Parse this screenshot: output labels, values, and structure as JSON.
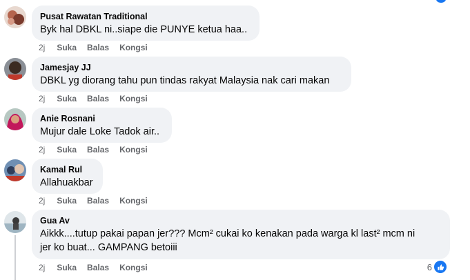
{
  "comments": [
    {
      "author": "Pusat Rawatan Traditional",
      "text": "Byk hal DBKL ni..siape die PUNYE ketua haa..",
      "time": "2j",
      "like_label": "Suka",
      "reply_label": "Balas",
      "share_label": "Kongsi",
      "avatar": "avatar-icon"
    },
    {
      "author": "Jamesjay JJ",
      "text": "DBKL yg diorang tahu pun tindas rakyat Malaysia nak cari makan",
      "time": "2j",
      "like_label": "Suka",
      "reply_label": "Balas",
      "share_label": "Kongsi",
      "avatar": "avatar-icon"
    },
    {
      "author": "Anie Rosnani",
      "text": "Mujur dale Loke Tadok air..",
      "time": "2j",
      "like_label": "Suka",
      "reply_label": "Balas",
      "share_label": "Kongsi",
      "avatar": "avatar-icon"
    },
    {
      "author": "Kamal Rul",
      "text": "Allahuakbar",
      "time": "2j",
      "like_label": "Suka",
      "reply_label": "Balas",
      "share_label": "Kongsi",
      "avatar": "avatar-icon"
    },
    {
      "author": "Gua Av",
      "text_line1": "Aikkk....tutup pakai papan jer??? Mcm² cukai ko kenakan pada warga kl last² mcm ni",
      "text_line2": "jer ko buat... GAMPANG betoiii",
      "time": "2j",
      "like_label": "Suka",
      "reply_label": "Balas",
      "share_label": "Kongsi",
      "avatar": "avatar-icon",
      "reaction_count": "6",
      "reaction_icon": "like-icon"
    }
  ],
  "colors": {
    "bubble": "#f0f2f5",
    "meta_text": "#65676b",
    "like_blue": "#1877f2"
  }
}
